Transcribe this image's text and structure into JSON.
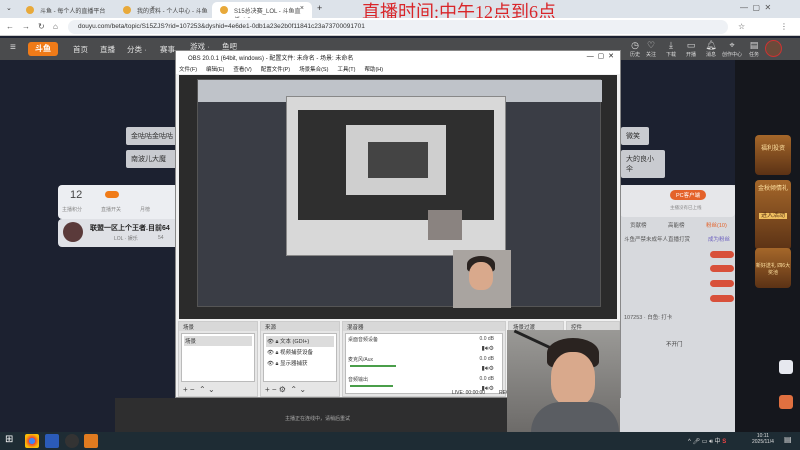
{
  "browser": {
    "tabs": [
      {
        "label": "斗鱼 - 每个人的直播平台"
      },
      {
        "label": "我的资料 - 个人中心 - 斗鱼"
      },
      {
        "label": "S15总决赛_LOL - 斗鱼直播_LO"
      }
    ],
    "new_tab": "+",
    "url": "douyu.com/beta/topic/S15ZJS?rid=107253&dyshid=4e6de1-0db1a23e2b0f11841c23a73700091701"
  },
  "overlay_title": "直播时间:中午12点到6点",
  "site": {
    "logo": "斗鱼",
    "nav": [
      "首页",
      "直播",
      "分类 ·",
      "赛事",
      "游戏 ·",
      "鱼吧"
    ],
    "header_icons": [
      {
        "icon": "history-icon",
        "label": "历史"
      },
      {
        "icon": "heart-icon",
        "label": "关注"
      },
      {
        "icon": "download-icon",
        "label": "下载"
      },
      {
        "icon": "camera-icon",
        "label": "开播"
      },
      {
        "icon": "bell-icon",
        "label": "消息"
      },
      {
        "icon": "location-icon",
        "label": "创作中心"
      },
      {
        "icon": "clipboard-icon",
        "label": "任务"
      }
    ],
    "banners_left": [
      "金咕咕金咕咕",
      "南波儿大魔"
    ],
    "banners_right": [
      "微笑",
      "大的良小伞"
    ],
    "stats": {
      "value": "12",
      "label": "主播积分",
      "toggle_label": "直播开关",
      "rank_label": "月榜"
    },
    "room_title": "联盟一区上个王者.目前64",
    "room_tag": "LOL · 娱乐",
    "room_count": "54",
    "pc_client": "PC客户端",
    "pc_note": "主播没有已上线",
    "chat_tabs": [
      "贡献榜",
      "高能榜",
      "粉丝(10)"
    ],
    "chat_notice": "斗鱼严禁未成年人直播打赏",
    "chat_become": "成为粉丝",
    "chat_user": "107253 · 白鱼: 打卡",
    "chat_msg": "不开门",
    "ads": [
      "福利投资",
      "金秋倾情礼",
      "进入活动",
      "新好送礼 四6大奖池"
    ]
  },
  "obs": {
    "title": "OBS 20.0.1 (64bit, windows) - 配置文件: 未命名 - 场景: 未命名",
    "menu": [
      "文件(F)",
      "编辑(E)",
      "查看(V)",
      "配置文件(P)",
      "场景集合(S)",
      "工具(T)",
      "帮助(H)"
    ],
    "scenes_header": "场景",
    "scenes": [
      "场景"
    ],
    "sources_header": "来源",
    "sources": [
      "文本 (GDI+)",
      "视频捕获设备",
      "显示器捕获"
    ],
    "mixer_header": "混音器",
    "mixer": [
      {
        "name": "桌面音频设备",
        "db": "0.0 dB",
        "level": 0
      },
      {
        "name": "麦克风/Aux",
        "db": "0.0 dB",
        "level": 60
      },
      {
        "name": "音频输出",
        "db": "0.0 dB",
        "level": 55
      }
    ],
    "transitions_header": "场景过渡",
    "controls_header": "控件",
    "status": "LIVE: 00:00:00",
    "status_rec": "REC"
  },
  "below_text": "主播正在连线中，请稍后重试",
  "taskbar": {
    "time": "10:11",
    "date": "2025/11/4"
  }
}
